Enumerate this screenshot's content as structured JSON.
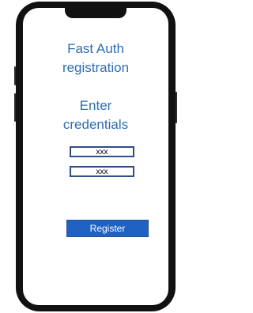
{
  "app": {
    "title_line1": "Fast Auth",
    "title_line2": "registration"
  },
  "credentials": {
    "heading_line1": "Enter",
    "heading_line2": "credentials",
    "fields": [
      {
        "value": "xxx"
      },
      {
        "value": "xxx"
      }
    ]
  },
  "actions": {
    "register_label": "Register"
  },
  "colors": {
    "accent_text": "#2e6db4",
    "button_background": "#1f62c2",
    "field_border": "#2f4e8a",
    "device_frame": "#111111"
  }
}
